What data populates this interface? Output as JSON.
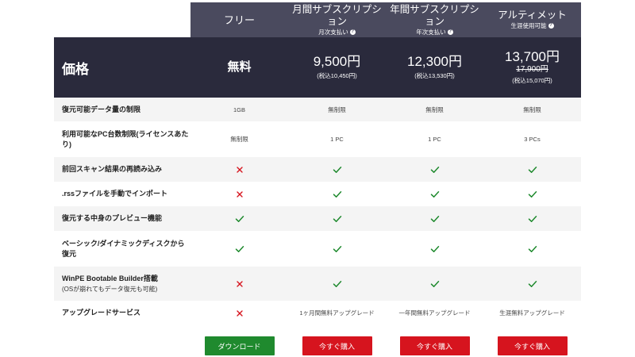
{
  "plans": [
    {
      "name": "フリー",
      "sub": "",
      "info": false
    },
    {
      "name": "月間サブスクリプション",
      "sub": "月次支払い",
      "info": true
    },
    {
      "name": "年間サブスクリプション",
      "sub": "年次支払い",
      "info": true
    },
    {
      "name": "アルティメット",
      "sub": "生涯使用可能",
      "info": true
    }
  ],
  "price_row": {
    "label": "価格",
    "prices": [
      {
        "main": "無料",
        "old": "",
        "tax": ""
      },
      {
        "main": "9,500円",
        "old": "",
        "tax": "(税込10,450円)"
      },
      {
        "main": "12,300円",
        "old": "",
        "tax": "(税込13,530円)"
      },
      {
        "main": "13,700円",
        "old": "17,900円",
        "tax": "(税込15,070円)"
      }
    ]
  },
  "features": [
    {
      "name": "復元可能データ量の制限",
      "sub": "",
      "values": [
        "1GB",
        "無制限",
        "無制限",
        "無制限"
      ]
    },
    {
      "name": "利用可能なPC台数制限(ライセンスあたり)",
      "sub": "",
      "values": [
        "無制限",
        "1 PC",
        "1 PC",
        "3 PCs"
      ]
    },
    {
      "name": "前回スキャン結果の再読み込み",
      "sub": "",
      "values": [
        "cross",
        "check",
        "check",
        "check"
      ]
    },
    {
      "name": ".rssファイルを手動でインポート",
      "sub": "",
      "values": [
        "cross",
        "check",
        "check",
        "check"
      ]
    },
    {
      "name": "復元する中身のプレビュー機能",
      "sub": "",
      "values": [
        "check",
        "check",
        "check",
        "check"
      ]
    },
    {
      "name": "ベーシック/ダイナミックディスクから復元",
      "sub": "",
      "values": [
        "check",
        "check",
        "check",
        "check"
      ]
    },
    {
      "name": "WinPE Bootable Builder搭載",
      "sub": "(OSが崩れてもデータ復元も可能)",
      "values": [
        "cross",
        "check",
        "check",
        "check"
      ]
    },
    {
      "name": "アップグレードサービス",
      "sub": "",
      "values": [
        "cross",
        "1ヶ月間無料アップグレード",
        "一年間無料アップグレード",
        "生涯無料アップグレード"
      ]
    }
  ],
  "buttons": [
    "ダウンロード",
    "今すぐ購入",
    "今すぐ購入",
    "今すぐ購入"
  ],
  "icon_legend": {
    "check": "check-icon",
    "cross": "cross-icon"
  },
  "colors": {
    "header_bg": "#4a4a5e",
    "price_bg": "#2a2a3c",
    "check": "#1f8a2e",
    "cross": "#d6141e",
    "download": "#1f8a2e",
    "buy": "#d6141e"
  }
}
